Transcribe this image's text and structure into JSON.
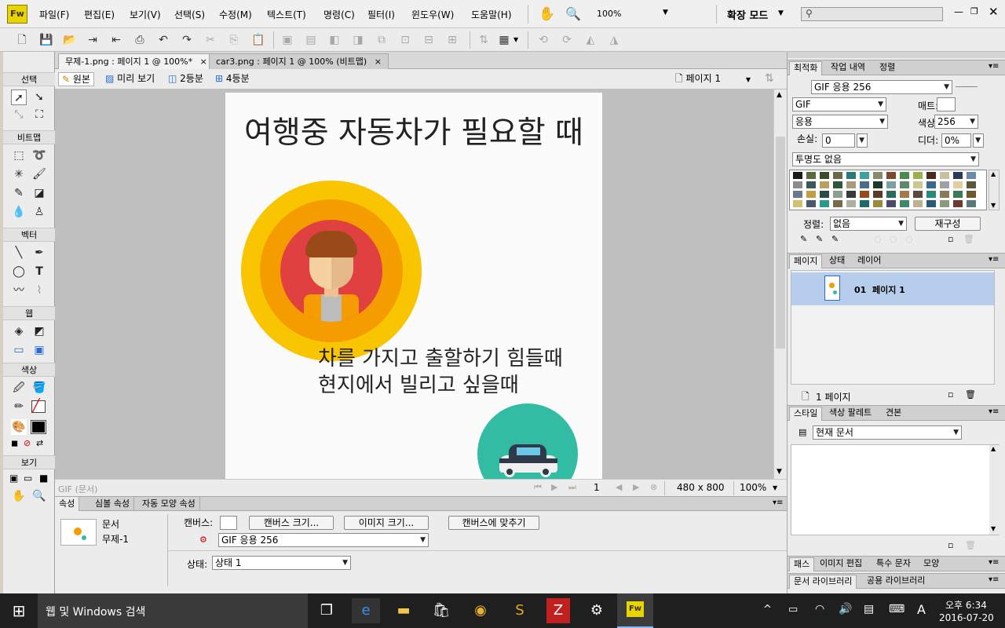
{
  "app": {
    "logo": "Fw"
  },
  "menu": {
    "items": [
      "파일(F)",
      "편집(E)",
      "보기(V)",
      "선택(S)",
      "수정(M)",
      "텍스트(T)",
      "명령(C)",
      "필터(I)",
      "윈도우(W)",
      "도움말(H)"
    ],
    "zoom_value": "100%",
    "mode": "확장 모드",
    "search_placeholder": ""
  },
  "tools": {
    "sections": [
      "선택",
      "비트맵",
      "벡터",
      "웹",
      "색상",
      "보기"
    ]
  },
  "doc_tabs": [
    {
      "label": "무제-1.png : 페이지 1 @ 100%*",
      "close": "×"
    },
    {
      "label": "car3.png : 페이지 1 @ 100% (비트맵)",
      "close": "×"
    }
  ],
  "view_bar": {
    "original": "원본",
    "preview": "미리 보기",
    "two_up": "2등분",
    "four_up": "4등분",
    "page": "페이지 1"
  },
  "canvas": {
    "heading": "여행중 자동차가 필요할 때",
    "line1": "차를 가지고 출할하기 힘들때",
    "line2": "현지에서 빌리고 싶을때"
  },
  "status": {
    "left": "GIF (문서)",
    "frame": "1",
    "size": "480 x 800",
    "zoom": "100%"
  },
  "props": {
    "tabs": [
      "속성",
      "심볼 속성",
      "자동 모양 속성"
    ],
    "doc_label": "문서",
    "doc_name": "무제-1",
    "canvas_label": "캔버스:",
    "canvas_size_btn": "캔버스 크기...",
    "image_size_btn": "이미지 크기...",
    "fit_canvas_btn": "캔버스에 맞추기",
    "format": "GIF 응용 256",
    "state_label": "상태:",
    "state_value": "상태 1"
  },
  "optimize": {
    "tabs": [
      "최적화",
      "작업 내역",
      "정렬"
    ],
    "preset": "GIF 응용 256",
    "format": "GIF",
    "matte_label": "매트:",
    "palette": "응용",
    "colors_label": "색상:",
    "colors_value": "256",
    "loss_label": "손실:",
    "loss_value": "0",
    "dither_label": "디더:",
    "dither_value": "0%",
    "transparency": "투명도 없음",
    "sort_label": "정렬:",
    "sort_value": "없음",
    "rebuild_btn": "재구성"
  },
  "pages": {
    "tabs": [
      "페이지",
      "상태",
      "레이어"
    ],
    "item": "01  페이지 1",
    "count": "1 페이지"
  },
  "styles": {
    "tabs": [
      "스타일",
      "색상 팔레트",
      "견본"
    ],
    "doc": "현재 문서"
  },
  "bottom_tabs1": [
    "패스",
    "이미지 편집",
    "특수 문자",
    "모양"
  ],
  "bottom_tabs2": [
    "문서 라이브러리",
    "공용 라이브러리"
  ],
  "taskbar": {
    "search": "웹 및 Windows 검색",
    "time": "오후 6:34",
    "date": "2016-07-20",
    "ime": "A"
  },
  "colors": {
    "accent": "#e8d400",
    "teal": "#32bca4",
    "yellow": "#f8c500",
    "orange": "#f49c00",
    "red": "#e04040"
  }
}
